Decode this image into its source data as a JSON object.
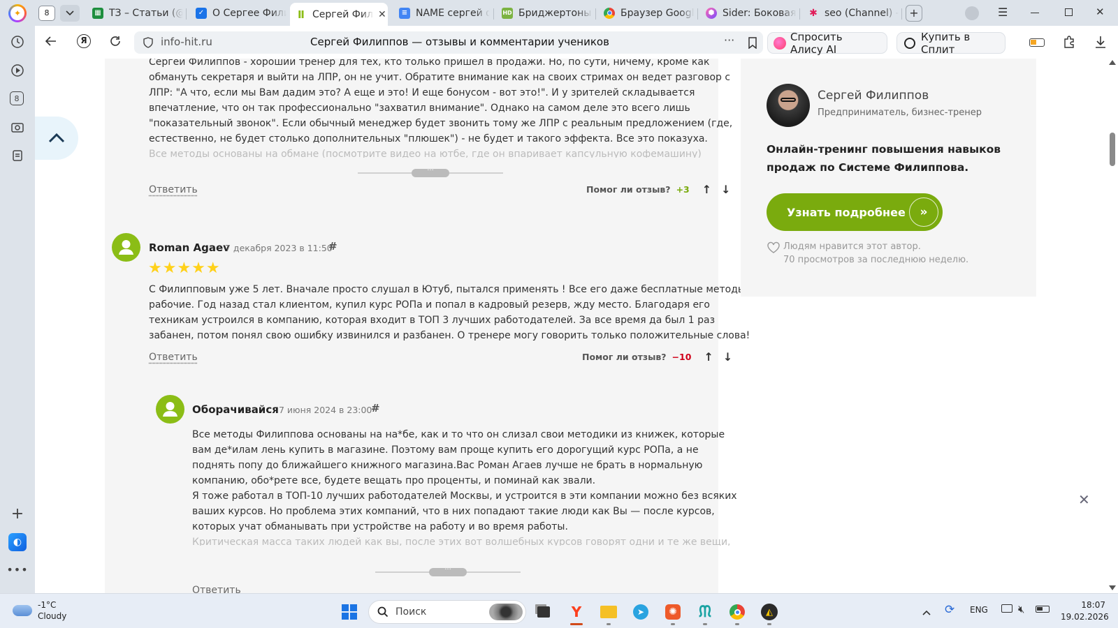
{
  "browser": {
    "tab_count": "8",
    "tabs": [
      {
        "title": "ТЗ – Статьи (@",
        "color": "#1e8e3e",
        "icon": "sheets-icon"
      },
      {
        "title": "О Сергее Фили",
        "color": "#1a73e8",
        "icon": "checkbox-icon"
      },
      {
        "title": "Сергей Фили",
        "color": "#8bbd16",
        "icon": "infohit-icon"
      },
      {
        "title": "NAME сергей ф",
        "color": "#4285f4",
        "icon": "docs-icon"
      },
      {
        "title": "Бриджертоны 3",
        "color": "#7cb342",
        "icon": "hd-icon"
      },
      {
        "title": "Браузер Google",
        "color": "#ea4335",
        "icon": "chrome-icon"
      },
      {
        "title": "Sider: Боковая г",
        "color": "#8e44ad",
        "icon": "sider-icon"
      },
      {
        "title": "seo (Channel) - [",
        "color": "#e01e5a",
        "icon": "slack-icon"
      }
    ],
    "address": "info-hit.ru",
    "page_title": "Сергей Филиппов — отзывы и комментарии учеников",
    "alice_button": "Спросить Алису AI",
    "split_button": "Купить в Сплит"
  },
  "sidebar": {
    "counter": "8"
  },
  "reviews": {
    "first": {
      "lines": [
        "Сергей Филиппов - хороший тренер для тех, кто только пришел в продажи. Но, по сути, ничему, кроме как",
        "обмануть секретаря и выйти на ЛПР, он не учит. Обратите внимание как на своих стримах он ведет разговор с",
        "ЛПР: \"А что, если мы Вам дадим это? А еще и это! И еще бонусом - вот это!\". И у зрителей складывается",
        "впечатление, что он так профессионально \"захватил внимание\". Однако на самом деле это всего лишь",
        "\"показательный звонок\". Если обычный менеджер будет звонить тому же ЛПР с реальным предложением (где,",
        "естественно, не будет столько дополнительных \"плюшек\") - не будет и такого эффекта. Все это показуха.",
        "Все методы основаны на обмане (посмотрите видео на ютбе, где он впаривает капсульную кофемашину)"
      ],
      "reply": "Ответить",
      "helpful_label": "Помог ли отзыв?",
      "score": "+3"
    },
    "second": {
      "name": "Roman Agaev",
      "date": "7 декабря 2023 в 11:50",
      "hash": "#",
      "stars": "★★★★★",
      "rating": 5,
      "lines": [
        "С Филипповым уже 5 лет. Вначале просто слушал в Ютуб, пытался применять ! Все его даже бесплатные методы",
        "рабочие. Год назад стал клиентом, купил курс РОПа и попал в кадровый резерв, жду место. Благодаря его",
        "техникам устроился в компанию, которая входит в ТОП 3 лучших работодателей. За все время да был 1 раз",
        "забанен, потом понял свою ошибку извинился и разбанен. О тренере могу говорить только положительные слова!"
      ],
      "reply": "Ответить",
      "helpful_label": "Помог ли отзыв?",
      "score": "−10"
    },
    "nested": {
      "name": "Оборачивайся",
      "date": "7 июня 2024 в 23:00",
      "hash": "#",
      "lines": [
        "Все методы Филиппова основаны на на*бе, как и то что он слизал свои методики из книжек, которые",
        "вам де*илам лень купить в магазине. Поэтому вам проще купить его дорогущий курс РОПа, а не",
        "поднять попу до ближайшего книжного магазина.Вас Роман Агаев лучше не брать в нормальную",
        "компанию, обо*рете все, будете вещать про проценты, и поминай как звали.",
        "Я тоже работал в ТОП-10 лучших работодателей Москвы, и устроится в эти компании можно без всяких",
        "ваших курсов. Но проблема этих компаний, что в них попадают такие люди как Вы — после курсов,",
        "которых учат обманывать при устройстве на работу и во время работы.",
        "Критическая масса таких людей как вы, после этих вот волшебных курсов говорят одни и те же вещи,"
      ],
      "reply": "Ответить"
    }
  },
  "aside": {
    "author_name": "Сергей Филиппов",
    "author_role": "Предприниматель, бизнес-тренер",
    "promo": "Онлайн-тренинг повышения навыков продаж по Системе Филиппова.",
    "cta": "Узнать подробнее",
    "likes": "Людям нравится этот автор.",
    "views": "70 просмотров за последнюю неделю."
  },
  "colors": {
    "accent_green": "#8bbd16",
    "cta_green": "#7aab0e",
    "score_positive": "#7aab0e",
    "score_negative": "#d0021b"
  },
  "taskbar": {
    "temperature": "-1°C",
    "weather": "Cloudy",
    "search_placeholder": "Поиск",
    "lang": "ENG",
    "time": "18:07",
    "date": "19.02.2026"
  }
}
